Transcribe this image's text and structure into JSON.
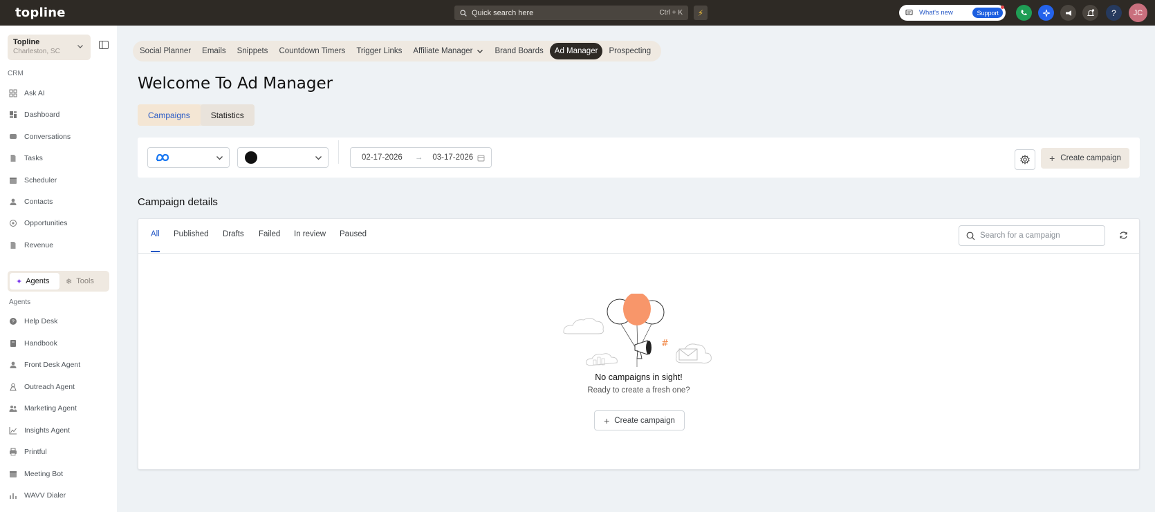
{
  "topbar": {
    "logo": "topline",
    "search_placeholder": "Quick search here",
    "search_shortcut": "Ctrl + K",
    "whats_new": "What's new",
    "support": "Support",
    "avatar_initials": "JC"
  },
  "sidebar": {
    "location_name": "Topline",
    "location_city": "Charleston, SC",
    "crm_label": "CRM",
    "crm_items": [
      {
        "label": "Ask AI",
        "icon": "grid-icon"
      },
      {
        "label": "Dashboard",
        "icon": "dashboard-icon"
      },
      {
        "label": "Conversations",
        "icon": "chat-icon"
      },
      {
        "label": "Tasks",
        "icon": "document-icon"
      },
      {
        "label": "Scheduler",
        "icon": "calendar-icon"
      },
      {
        "label": "Contacts",
        "icon": "person-icon"
      },
      {
        "label": "Opportunities",
        "icon": "target-icon"
      },
      {
        "label": "Revenue",
        "icon": "document-icon"
      }
    ],
    "segment_agents": "Agents",
    "segment_tools": "Tools",
    "agents_label": "Agents",
    "agent_items": [
      {
        "label": "Help Desk",
        "icon": "help-icon"
      },
      {
        "label": "Handbook",
        "icon": "book-icon"
      },
      {
        "label": "Front Desk Agent",
        "icon": "person-icon"
      },
      {
        "label": "Outreach Agent",
        "icon": "outreach-icon"
      },
      {
        "label": "Marketing Agent",
        "icon": "people-icon"
      },
      {
        "label": "Insights Agent",
        "icon": "chart-icon"
      },
      {
        "label": "Printful",
        "icon": "printer-icon"
      },
      {
        "label": "Meeting Bot",
        "icon": "calendar-icon"
      },
      {
        "label": "WAVV Dialer",
        "icon": "dialer-icon"
      }
    ]
  },
  "top_tabs": [
    "Social Planner",
    "Emails",
    "Snippets",
    "Countdown Timers",
    "Trigger Links",
    "Affiliate Manager",
    "Brand Boards",
    "Ad Manager",
    "Prospecting"
  ],
  "active_top_tab": "Ad Manager",
  "page": {
    "title": "Welcome To Ad Manager",
    "subtabs": [
      "Campaigns",
      "Statistics"
    ],
    "active_subtab": "Campaigns"
  },
  "filters": {
    "platform_icon": "meta-icon",
    "date_start": "02-17-2026",
    "date_end": "03-17-2026",
    "create_campaign": "Create campaign"
  },
  "campaigns": {
    "section_title": "Campaign details",
    "status_tabs": [
      "All",
      "Published",
      "Drafts",
      "Failed",
      "In review",
      "Paused"
    ],
    "active_status_tab": "All",
    "search_placeholder": "Search for a campaign",
    "empty_title": "No campaigns in sight!",
    "empty_subtitle": "Ready to create a fresh one?",
    "empty_button": "Create campaign"
  },
  "colors": {
    "topbar": "#2e2a25",
    "accent_blue": "#2457c5",
    "beige": "#efe9e1",
    "balloon_orange": "#f8966a",
    "avatar": "#c96f7d"
  }
}
